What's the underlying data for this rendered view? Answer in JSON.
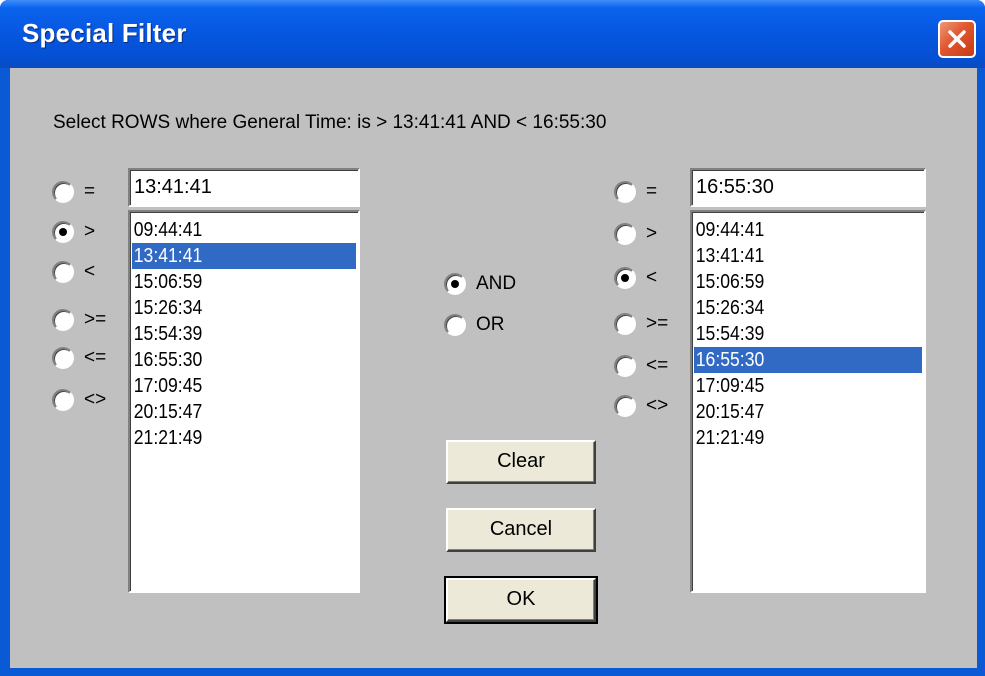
{
  "window": {
    "title": "Special Filter"
  },
  "prompt": "Select ROWS where General Time: is > 13:41:41 AND < 16:55:30",
  "left": {
    "input_value": "13:41:41",
    "operators": [
      {
        "label": "=",
        "checked": false
      },
      {
        "label": ">",
        "checked": true
      },
      {
        "label": "<",
        "checked": false
      },
      {
        "label": ">=",
        "checked": false
      },
      {
        "label": "<=",
        "checked": false
      },
      {
        "label": "<>",
        "checked": false
      }
    ],
    "items": [
      "09:44:41",
      "13:41:41",
      "15:06:59",
      "15:26:34",
      "15:54:39",
      "16:55:30",
      "17:09:45",
      "20:15:47",
      "21:21:49"
    ],
    "selected_index": 1
  },
  "logic": [
    {
      "label": "AND",
      "checked": true
    },
    {
      "label": "OR",
      "checked": false
    }
  ],
  "right": {
    "input_value": "16:55:30",
    "operators": [
      {
        "label": "=",
        "checked": false
      },
      {
        "label": ">",
        "checked": false
      },
      {
        "label": "<",
        "checked": true
      },
      {
        "label": ">=",
        "checked": false
      },
      {
        "label": "<=",
        "checked": false
      },
      {
        "label": "<>",
        "checked": false
      }
    ],
    "items": [
      "09:44:41",
      "13:41:41",
      "15:06:59",
      "15:26:34",
      "15:54:39",
      "16:55:30",
      "17:09:45",
      "20:15:47",
      "21:21:49"
    ],
    "selected_index": 5
  },
  "buttons": {
    "clear": "Clear",
    "cancel": "Cancel",
    "ok": "OK"
  },
  "colors": {
    "selection": "#316ac5",
    "dialog_bg": "#c0c0c0",
    "titlebar": "#0656e0",
    "close_button": "#e0562f"
  },
  "icons": {
    "close": "close-x-icon"
  }
}
